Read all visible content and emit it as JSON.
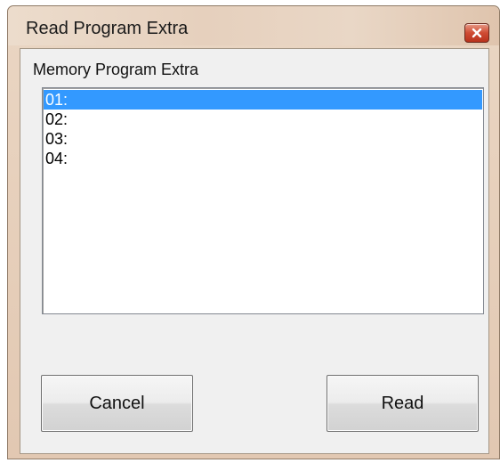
{
  "window": {
    "title": "Read Program Extra"
  },
  "group": {
    "label": "Memory Program Extra"
  },
  "list": {
    "items": [
      {
        "label": "01:",
        "selected": true
      },
      {
        "label": "02:",
        "selected": false
      },
      {
        "label": "03:",
        "selected": false
      },
      {
        "label": "04:",
        "selected": false
      }
    ]
  },
  "buttons": {
    "cancel_label": "Cancel",
    "read_label": "Read"
  },
  "icons": {
    "close": "close-icon"
  },
  "colors": {
    "selection": "#3399ff",
    "close_button": "#cf4b33"
  }
}
